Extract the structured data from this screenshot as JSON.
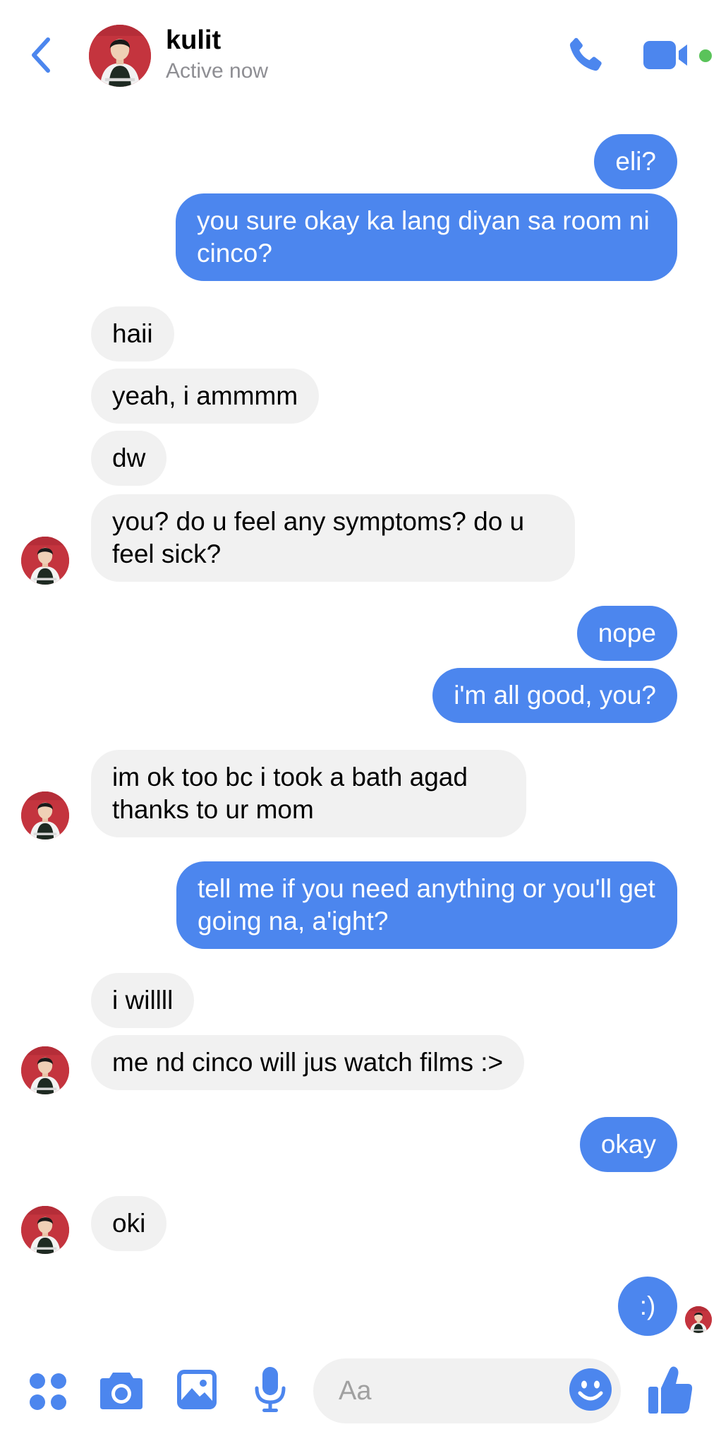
{
  "header": {
    "contact_name": "kulit",
    "status": "Active now"
  },
  "messages": [
    {
      "side": "out",
      "text": "eli?"
    },
    {
      "side": "out",
      "text": "you sure okay ka lang diyan sa room ni cinco?"
    },
    {
      "side": "in",
      "text": "haii"
    },
    {
      "side": "in",
      "text": "yeah, i ammmm"
    },
    {
      "side": "in",
      "text": "dw"
    },
    {
      "side": "in",
      "text": "you? do u feel any symptoms? do u feel sick?"
    },
    {
      "side": "out",
      "text": "nope"
    },
    {
      "side": "out",
      "text": "i'm all good, you?"
    },
    {
      "side": "in",
      "text": "im ok too bc i took a bath agad thanks to ur mom"
    },
    {
      "side": "out",
      "text": "tell me if you need anything or you'll get going na, a'ight?"
    },
    {
      "side": "in",
      "text": "i willll"
    },
    {
      "side": "in",
      "text": "me nd cinco will jus watch films :>"
    },
    {
      "side": "out",
      "text": "okay"
    },
    {
      "side": "in",
      "text": "oki"
    },
    {
      "side": "out",
      "text": ":)"
    }
  ],
  "composer": {
    "placeholder": "Aa"
  },
  "icons": {
    "back": "chevron-left-icon",
    "call": "phone-icon",
    "video": "video-camera-icon",
    "menu": "four-dots-icon",
    "camera": "camera-icon",
    "gallery": "image-icon",
    "voice": "microphone-icon",
    "emoji": "smiley-icon",
    "like": "thumbs-up-icon"
  },
  "colors": {
    "accent": "#4c86ee",
    "outgoing_bubble": "#4c86ee",
    "incoming_bubble": "#f1f1f1",
    "online": "#5ac35a"
  }
}
